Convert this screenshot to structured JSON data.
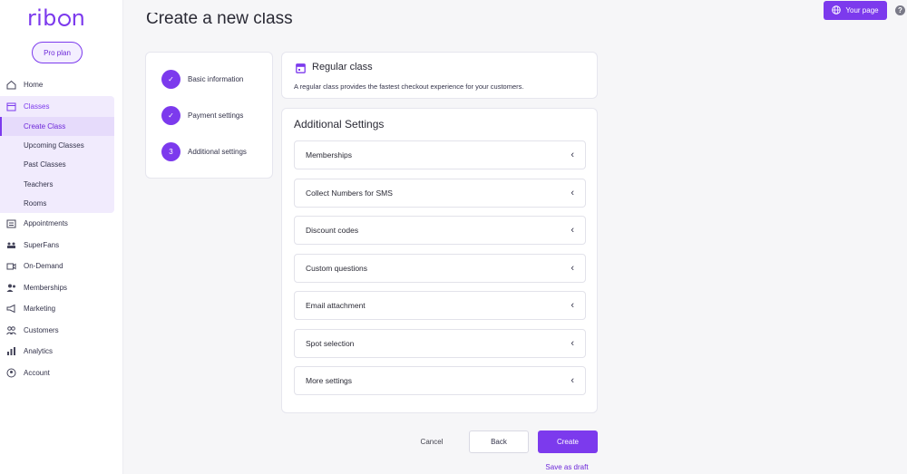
{
  "brand": {
    "logo_prefix": "rib",
    "logo_suffix": "n",
    "plan_label": "Pro plan",
    "accent": "#7c3aed"
  },
  "topbar": {
    "your_page_label": "Your page",
    "help_label": "?"
  },
  "sidebar": {
    "items": [
      {
        "label": "Home",
        "icon": "home-icon"
      },
      {
        "label": "Classes",
        "icon": "classes-icon"
      },
      {
        "label": "Appointments",
        "icon": "calendar-icon"
      },
      {
        "label": "SuperFans",
        "icon": "superfans-icon"
      },
      {
        "label": "On-Demand",
        "icon": "video-icon"
      },
      {
        "label": "Memberships",
        "icon": "users-icon"
      },
      {
        "label": "Marketing",
        "icon": "megaphone-icon"
      },
      {
        "label": "Customers",
        "icon": "customers-icon"
      },
      {
        "label": "Analytics",
        "icon": "chart-icon"
      },
      {
        "label": "Account",
        "icon": "account-icon"
      }
    ],
    "class_subitems": [
      "Create Class",
      "Upcoming Classes",
      "Past Classes",
      "Teachers",
      "Rooms"
    ]
  },
  "main": {
    "title": "Create a new class",
    "steps": [
      {
        "marker": "✓",
        "label": "Basic information"
      },
      {
        "marker": "✓",
        "label": "Payment settings"
      },
      {
        "marker": "3",
        "label": "Additional settings"
      }
    ],
    "class_type": {
      "title": "Regular class",
      "description": "A regular class provides the fastest checkout experience for your customers."
    },
    "additional_settings": {
      "title": "Additional Settings",
      "sections": [
        "Memberships",
        "Collect Numbers for SMS",
        "Discount codes",
        "Custom questions",
        "Email attachment",
        "Spot selection",
        "More settings"
      ]
    },
    "actions": {
      "cancel": "Cancel",
      "back": "Back",
      "create": "Create",
      "save_draft": "Save as draft"
    }
  }
}
